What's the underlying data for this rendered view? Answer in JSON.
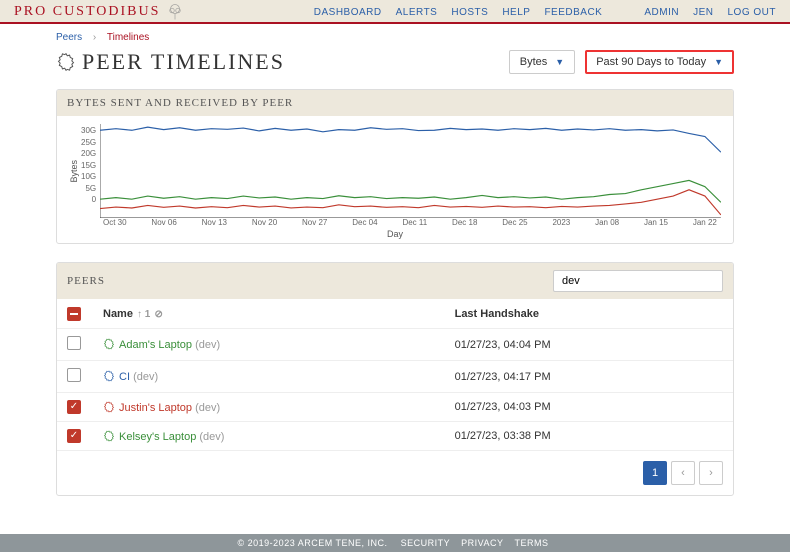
{
  "brand": "PRO CUSTODIBUS",
  "nav": {
    "dashboard": "DASHBOARD",
    "alerts": "ALERTS",
    "hosts": "HOSTS",
    "help": "HELP",
    "feedback": "FEEDBACK",
    "admin": "ADMIN",
    "user": "JEN",
    "logout": "LOG OUT"
  },
  "breadcrumb": {
    "root": "Peers",
    "sep": "›",
    "current": "Timelines"
  },
  "title": "PEER TIMELINES",
  "metric_select": "Bytes",
  "range_select": "Past 90 Days to Today",
  "chart_panel_title": "BYTES SENT AND RECEIVED BY PEER",
  "chart_data": {
    "type": "line",
    "ylabel": "Bytes",
    "xlabel": "Day",
    "yticks": [
      "30G",
      "25G",
      "20G",
      "15G",
      "10G",
      "5G",
      "0"
    ],
    "ylim": [
      0,
      30
    ],
    "xticks": [
      "Oct 30",
      "Nov 06",
      "Nov 13",
      "Nov 20",
      "Nov 27",
      "Dec 04",
      "Dec 11",
      "Dec 18",
      "Dec 25",
      "2023",
      "Jan 08",
      "Jan 15",
      "Jan 22"
    ],
    "series": [
      {
        "name": "blue",
        "color": "#2b5fa8",
        "values": [
          28,
          28.5,
          28,
          29,
          28.2,
          28.8,
          28,
          28.5,
          28.3,
          28.7,
          27.8,
          28.6,
          28,
          28.4,
          27.5,
          28.2,
          28,
          28.8,
          28.3,
          28.5,
          27.9,
          28,
          28.6,
          28.2,
          28.4,
          28,
          28.5,
          28.2,
          28.6,
          28,
          28.4,
          28.1,
          28.5,
          28,
          28.2,
          27.8,
          28.1,
          27,
          26,
          21
        ]
      },
      {
        "name": "green",
        "color": "#3a8f3a",
        "values": [
          6,
          6.5,
          6,
          7,
          6.3,
          6.8,
          6,
          6.5,
          6.2,
          7,
          6.4,
          6.7,
          6,
          6.5,
          6.2,
          7.1,
          6.5,
          6.8,
          6.2,
          6.5,
          6.3,
          6.7,
          6,
          6.5,
          7.2,
          6.5,
          6.8,
          6.4,
          6.7,
          6,
          6.5,
          6.8,
          7.5,
          7.8,
          9,
          10,
          11,
          12,
          10,
          5
        ]
      },
      {
        "name": "red",
        "color": "#c0392b",
        "values": [
          3,
          3.5,
          3.2,
          4,
          3.4,
          3.8,
          3.2,
          3.6,
          3.3,
          4,
          3.5,
          3.8,
          3.2,
          3.5,
          3.3,
          4.2,
          3.6,
          3.8,
          3.4,
          3.6,
          3.3,
          4,
          3.5,
          3.7,
          3.4,
          3.8,
          3.5,
          3.6,
          3.3,
          3.7,
          3.5,
          3.8,
          4,
          4.5,
          5,
          6,
          7,
          9,
          7,
          1
        ]
      }
    ]
  },
  "peers_panel_title": "PEERS",
  "search_value": "dev",
  "columns": {
    "name": "Name",
    "name_sort": "↑ 1",
    "handshake": "Last Handshake"
  },
  "rows": [
    {
      "checked": false,
      "color": "green",
      "name": "Adam's Laptop",
      "suffix": "(dev)",
      "handshake": "01/27/23, 04:04 PM"
    },
    {
      "checked": false,
      "color": "blue",
      "name": "CI",
      "suffix": "(dev)",
      "handshake": "01/27/23, 04:17 PM"
    },
    {
      "checked": true,
      "color": "redt",
      "name": "Justin's Laptop",
      "suffix": "(dev)",
      "handshake": "01/27/23, 04:03 PM"
    },
    {
      "checked": true,
      "color": "green",
      "name": "Kelsey's Laptop",
      "suffix": "(dev)",
      "handshake": "01/27/23, 03:38 PM"
    }
  ],
  "page_current": "1",
  "footer": {
    "copyright": "© 2019-2023 ARCEM TENE, INC.",
    "security": "SECURITY",
    "privacy": "PRIVACY",
    "terms": "TERMS"
  }
}
